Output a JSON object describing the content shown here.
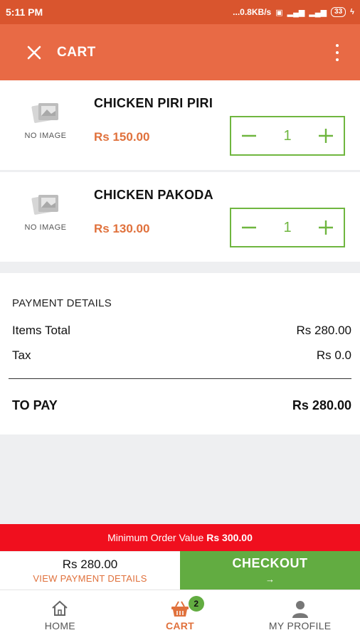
{
  "status_bar": {
    "time": "5:11 PM",
    "network_speed": "...0.8KB/s",
    "battery": "33"
  },
  "app_bar": {
    "title": "CART"
  },
  "cart_items": [
    {
      "image_placeholder": "NO IMAGE",
      "name": "CHICKEN PIRI PIRI",
      "price": "Rs 150.00",
      "quantity": "1"
    },
    {
      "image_placeholder": "NO IMAGE",
      "name": "CHICKEN PAKODA",
      "price": "Rs 130.00",
      "quantity": "1"
    }
  ],
  "payment_details": {
    "heading": "PAYMENT DETAILS",
    "items_total_label": "Items Total",
    "items_total_value": "Rs 280.00",
    "tax_label": "Tax",
    "tax_value": "Rs 0.0",
    "to_pay_label": "TO PAY",
    "to_pay_value": "Rs 280.00"
  },
  "min_order": {
    "label": "Minimum Order Value",
    "value": "Rs 300.00"
  },
  "checkout_bar": {
    "total": "Rs 280.00",
    "view_details": "VIEW PAYMENT DETAILS",
    "checkout_label": "CHECKOUT",
    "checkout_arrow": "→"
  },
  "bottom_nav": {
    "home": "HOME",
    "cart": "CART",
    "cart_badge": "2",
    "profile": "MY PROFILE"
  },
  "colors": {
    "status_bar": "#d9552e",
    "app_bar": "#e86a45",
    "accent_orange": "#e0713c",
    "green": "#62ac41",
    "stepper_green": "#6fb63f",
    "min_order_red": "#f00f1e"
  }
}
